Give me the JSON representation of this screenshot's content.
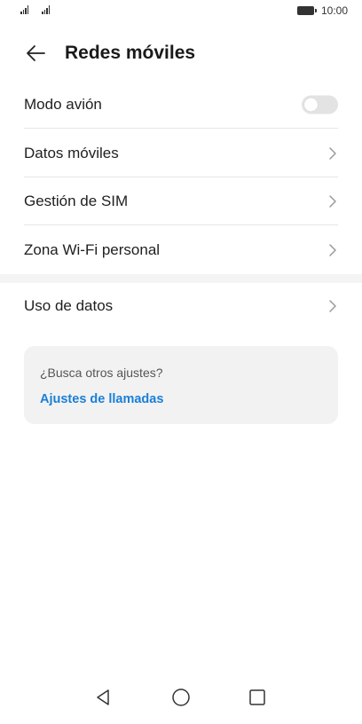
{
  "status_bar": {
    "time": "10:00"
  },
  "header": {
    "title": "Redes móviles",
    "back_icon": "arrow-left-icon"
  },
  "settings": {
    "airplane_mode": {
      "label": "Modo avión",
      "enabled": false
    },
    "items": [
      {
        "label": "Datos móviles"
      },
      {
        "label": "Gestión de SIM"
      },
      {
        "label": "Zona Wi-Fi personal"
      }
    ],
    "data_usage": {
      "label": "Uso de datos"
    }
  },
  "suggestion": {
    "question": "¿Busca otros ajustes?",
    "link": "Ajustes de llamadas"
  },
  "colors": {
    "link": "#1a7fd6",
    "toggle_off": "#e3e3e3",
    "card_bg": "#f2f2f2"
  }
}
